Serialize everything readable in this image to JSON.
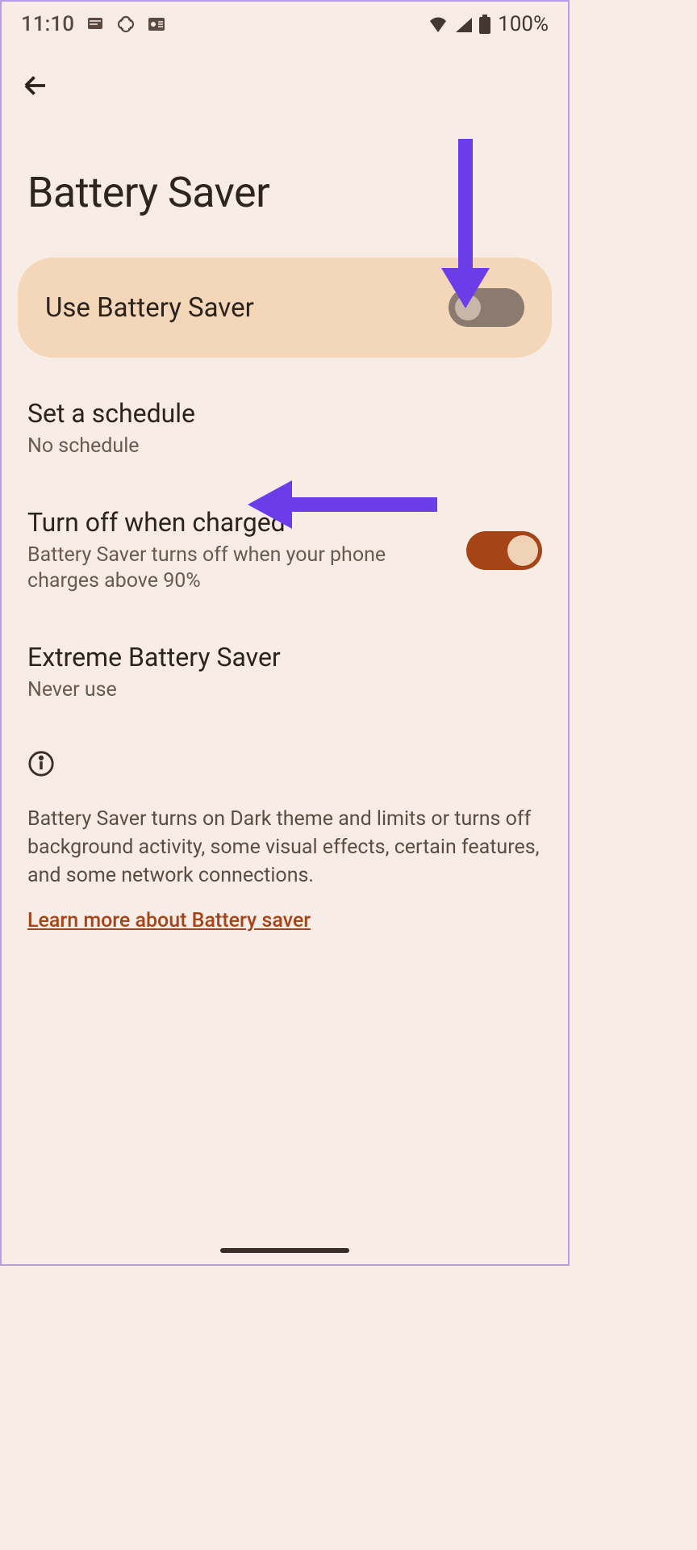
{
  "status": {
    "time": "11:10",
    "battery_pct": "100%"
  },
  "header": {
    "title": "Battery Saver"
  },
  "main_toggle": {
    "label": "Use Battery Saver",
    "state": "off"
  },
  "settings": {
    "schedule": {
      "title": "Set a schedule",
      "sub": "No schedule"
    },
    "turn_off_charged": {
      "title": "Turn off when charged",
      "sub": "Battery Saver turns off when your phone charges above 90%",
      "state": "on"
    },
    "extreme": {
      "title": "Extreme Battery Saver",
      "sub": "Never use"
    }
  },
  "info": {
    "text": "Battery Saver turns on Dark theme and limits or turns off background activity, some visual effects, certain features, and some network connections.",
    "link": "Learn more about Battery saver"
  }
}
